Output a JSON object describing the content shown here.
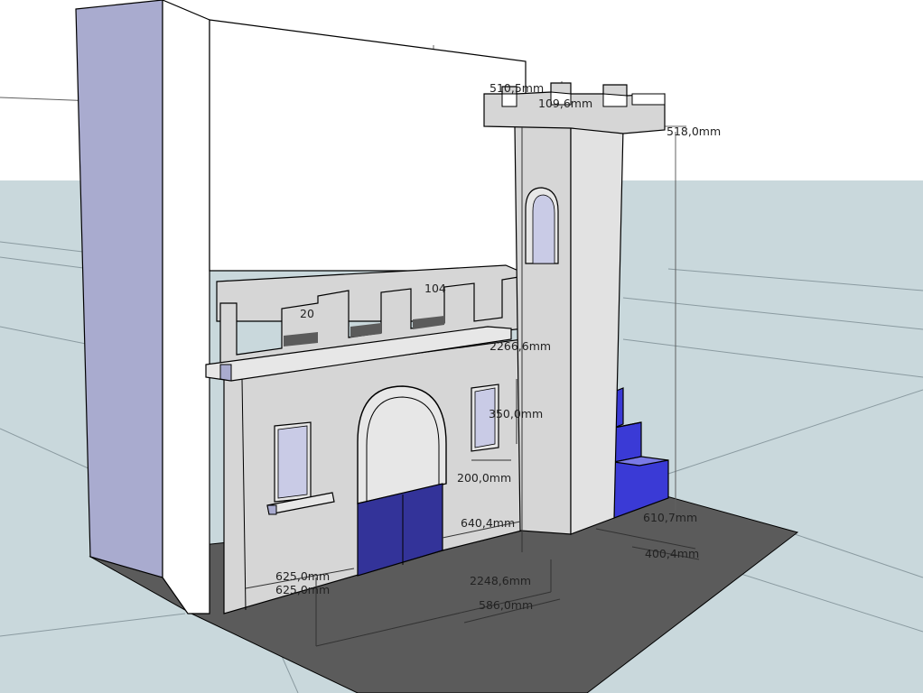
{
  "colors": {
    "sky": "#ffffff",
    "ground": "#c9d8dc",
    "ground_slab": "#5b5b5b",
    "face": "#d6d6d6",
    "face_light": "#e7e7e7",
    "side_shadow": "#a9abcf",
    "wall_white": "#ffffff",
    "blue_dark": "#333399",
    "blue_bright": "#3a3ad6",
    "window_tint": "#c9cbe6",
    "edge": "#000000",
    "guide": "#606060"
  },
  "dimensions": [
    {
      "id": "dim-tower-width",
      "text": "510,5mm"
    },
    {
      "id": "dim-merlon",
      "text": "109,6mm"
    },
    {
      "id": "dim-tower-top",
      "text": "518,0mm"
    },
    {
      "id": "dim-rear-wall",
      "text": "104"
    },
    {
      "id": "dim-battlement",
      "text": "20"
    },
    {
      "id": "dim-tower-height",
      "text": "2266,6mm"
    },
    {
      "id": "dim-window-height",
      "text": "350,0mm"
    },
    {
      "id": "dim-window-width",
      "text": "200,0mm"
    },
    {
      "id": "dim-door-width",
      "text": "640,4mm"
    },
    {
      "id": "dim-stair-depth",
      "text": "610,7mm"
    },
    {
      "id": "dim-stair-step",
      "text": "400,4mm"
    },
    {
      "id": "dim-left-a",
      "text": "625,0mm"
    },
    {
      "id": "dim-left-b",
      "text": "625,0mm"
    },
    {
      "id": "dim-total-length",
      "text": "2248,6mm"
    },
    {
      "id": "dim-base-depth",
      "text": "586,0mm"
    }
  ]
}
